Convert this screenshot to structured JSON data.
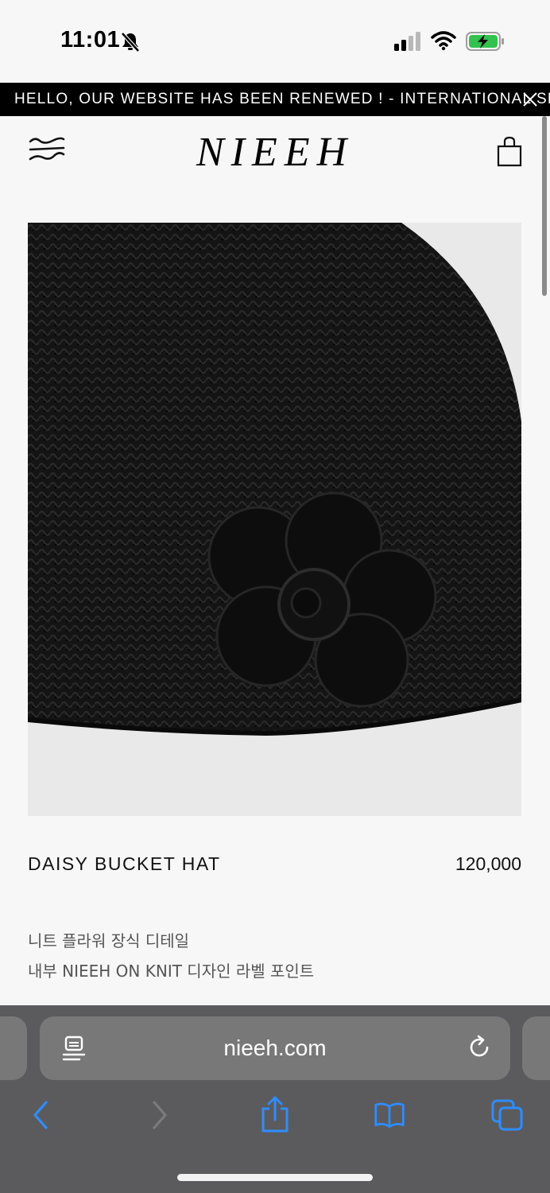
{
  "status_bar": {
    "time": "11:01",
    "icons": [
      "bell-slash-icon",
      "signal-icon",
      "wifi-icon",
      "battery-charging-icon"
    ]
  },
  "announcement": {
    "text": "HELLO, OUR WEBSITE HAS BEEN RENEWED ! - INTERNATIONAL SHIPP",
    "close_icon": "close-icon"
  },
  "header": {
    "logo": "NIEEH",
    "menu_icon": "menu-icon",
    "bag_icon": "shopping-bag-icon"
  },
  "product": {
    "name": "DAISY BUCKET HAT",
    "price": "120,000",
    "description": [
      "니트 플라워 장식 디테일",
      "내부 NIEEH ON KNIT 디자인 라벨 포인트"
    ]
  },
  "browser": {
    "url": "nieeh.com",
    "toolbar_icons": [
      "back-icon",
      "forward-icon",
      "share-icon",
      "bookmarks-icon",
      "tabs-icon"
    ]
  },
  "colors": {
    "accent": "#2f8cff",
    "announcement_bg": "#000000",
    "browser_bg": "#5b5b5e",
    "page_bg": "#f7f7f7"
  }
}
